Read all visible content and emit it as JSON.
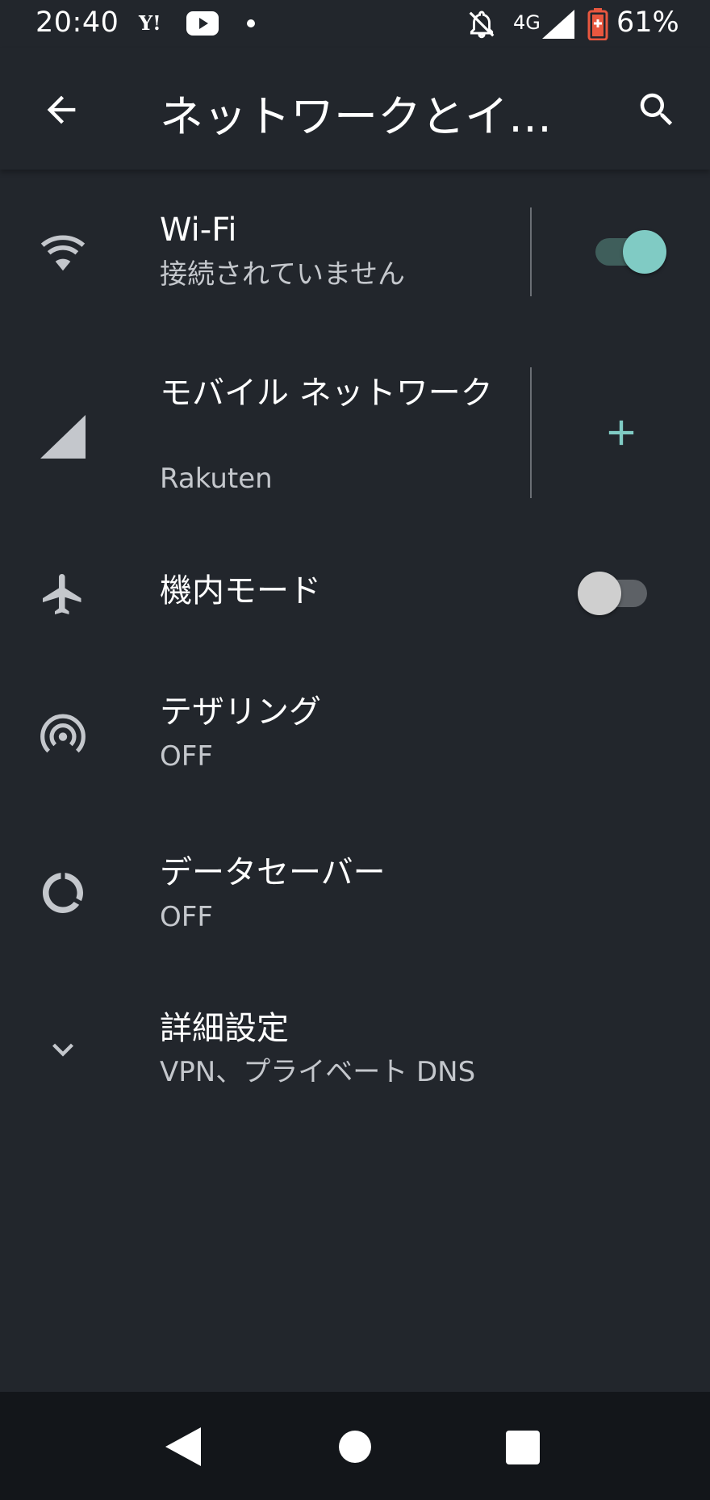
{
  "status_bar": {
    "time": "20:40",
    "yahoo_icon_text": "Y!",
    "network_type": "4G",
    "battery_percent": "61%",
    "icons": [
      "yahoo-icon",
      "youtube-icon",
      "notification-dot-icon",
      "bell-off-icon",
      "signal-icon",
      "battery-icon"
    ]
  },
  "app_bar": {
    "title": "ネットワークとインターネット",
    "back_icon": "arrow-back-icon",
    "search_icon": "search-icon"
  },
  "items": [
    {
      "id": "wifi",
      "title": "Wi-Fi",
      "subtitle": "接続されていません",
      "icon": "wifi-icon",
      "toggle_on": true
    },
    {
      "id": "mobile",
      "title": "モバイル ネットワーク",
      "subtitle": "Rakuten",
      "icon": "cellular-signal-icon",
      "action_icon": "plus-icon"
    },
    {
      "id": "airplane",
      "title": "機内モード",
      "icon": "airplane-icon",
      "toggle_on": false
    },
    {
      "id": "tethering",
      "title": "テザリング",
      "subtitle": "OFF",
      "icon": "hotspot-icon"
    },
    {
      "id": "datasaver",
      "title": "データセーバー",
      "subtitle": "OFF",
      "icon": "data-saver-icon"
    },
    {
      "id": "advanced",
      "title": "詳細設定",
      "subtitle": "VPN、プライベート DNS",
      "icon": "chevron-down-icon"
    }
  ],
  "colors": {
    "background": "#22262c",
    "accent": "#80cbc4",
    "icon_gray": "#c4c7cc",
    "nav_bar": "#13161a",
    "battery_low": "#e8573f"
  },
  "nav_bar": {
    "icons": [
      "nav-back-icon",
      "nav-home-icon",
      "nav-recents-icon"
    ]
  }
}
